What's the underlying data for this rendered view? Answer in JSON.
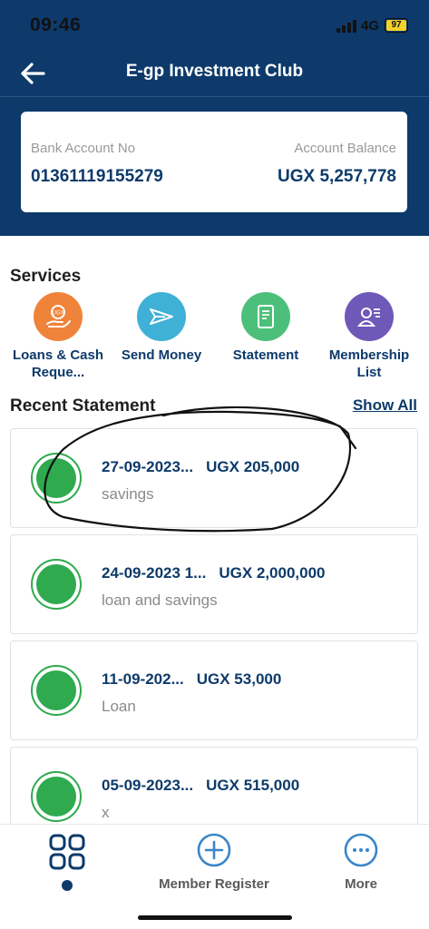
{
  "status_bar": {
    "time": "09:46",
    "network": "4G",
    "battery": "97"
  },
  "header": {
    "title": "E-gp Investment Club"
  },
  "account": {
    "bank_account_label": "Bank Account No",
    "bank_account_value": "01361119155279",
    "balance_label": "Account Balance",
    "balance_value": "UGX 5,257,778"
  },
  "services": {
    "title": "Services",
    "items": [
      {
        "label": "Loans & Cash Reque...",
        "icon": "loan-hand-icon",
        "color": "#f0833a"
      },
      {
        "label": "Send Money",
        "icon": "send-plane-icon",
        "color": "#3fb0d6"
      },
      {
        "label": "Statement",
        "icon": "document-icon",
        "color": "#4cc07a"
      },
      {
        "label": "Membership List",
        "icon": "member-list-icon",
        "color": "#6e59b8"
      }
    ]
  },
  "recent": {
    "title": "Recent Statement",
    "show_all": "Show All",
    "items": [
      {
        "date": "27-09-2023...",
        "amount": "UGX 205,000",
        "desc": "savings"
      },
      {
        "date": "24-09-2023 1...",
        "amount": "UGX 2,000,000",
        "desc": "loan and savings"
      },
      {
        "date": "11-09-202...",
        "amount": "UGX 53,000",
        "desc": "Loan"
      },
      {
        "date": "05-09-2023...",
        "amount": "UGX 515,000",
        "desc": "x"
      }
    ]
  },
  "bottom_nav": {
    "register_label": "Member Register",
    "more_label": "More"
  },
  "colors": {
    "primary": "#0d3a6b",
    "green": "#2faa4f"
  }
}
